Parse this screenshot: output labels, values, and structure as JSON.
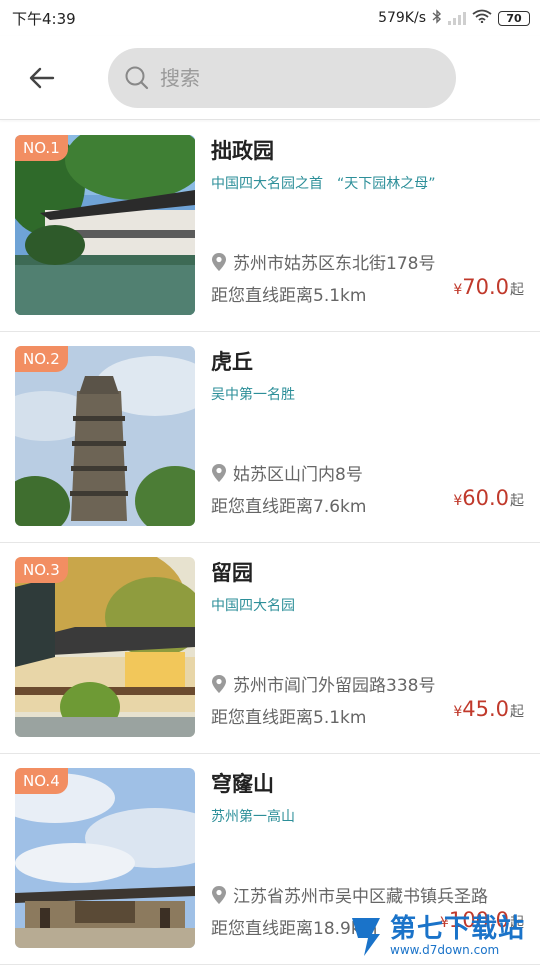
{
  "status": {
    "time": "下午4:39",
    "net_speed": "579K/s",
    "battery": "70"
  },
  "search": {
    "placeholder": "搜索"
  },
  "items": [
    {
      "rank": "NO.1",
      "name": "拙政园",
      "tag": "中国四大名园之首　“天下园林之母”",
      "address": "苏州市姑苏区东北街178号",
      "distance": "距您直线距离5.1km",
      "price_symbol": "¥",
      "price": "70.0",
      "price_suffix": "起"
    },
    {
      "rank": "NO.2",
      "name": "虎丘",
      "tag": "吴中第一名胜",
      "address": "姑苏区山门内8号",
      "distance": "距您直线距离7.6km",
      "price_symbol": "¥",
      "price": "60.0",
      "price_suffix": "起"
    },
    {
      "rank": "NO.3",
      "name": "留园",
      "tag": "中国四大名园",
      "address": "苏州市阊门外留园路338号",
      "distance": "距您直线距离5.1km",
      "price_symbol": "¥",
      "price": "45.0",
      "price_suffix": "起"
    },
    {
      "rank": "NO.4",
      "name": "穹窿山",
      "tag": "苏州第一高山",
      "address": "江苏省苏州市吴中区藏书镇兵圣路",
      "distance": "距您直线距离18.9km",
      "price_symbol": "¥",
      "price": "100.0",
      "price_suffix": "起"
    }
  ],
  "watermark": {
    "cn": "第七下载站",
    "en": "www.d7down.com"
  },
  "colors": {
    "rank_badge": "#f28e62",
    "tag_text": "#2d8f99",
    "price": "#c0392b",
    "search_bg": "#e0e0e0"
  },
  "icons": [
    "back-arrow-icon",
    "search-icon",
    "location-pin-icon",
    "wifi-icon",
    "bluetooth-icon",
    "signal-icon",
    "battery-icon"
  ]
}
